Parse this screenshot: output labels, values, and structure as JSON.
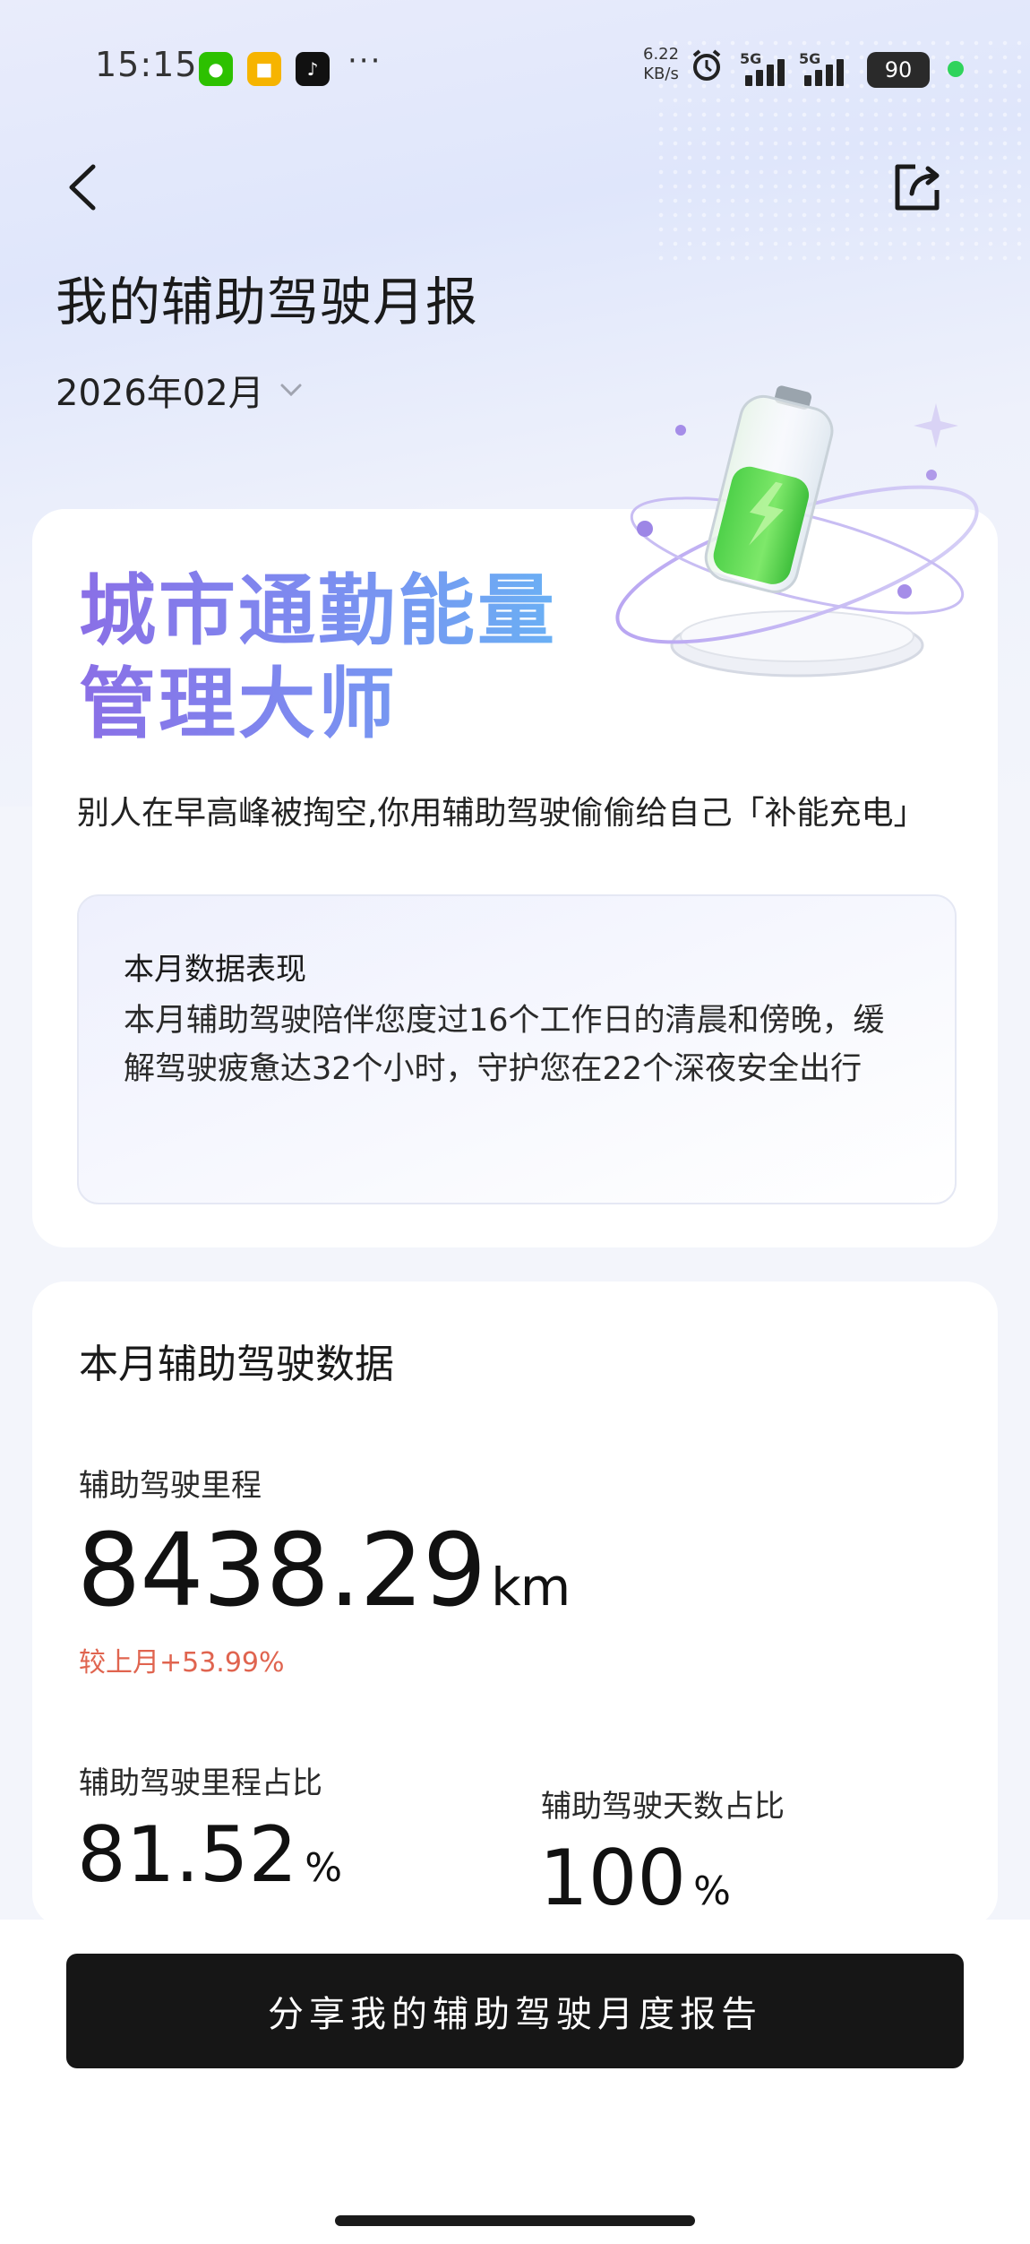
{
  "status_bar": {
    "time": "15:15",
    "net_speed_value": "6.22",
    "net_speed_unit": "KB/s",
    "signal1": "5G",
    "signal2": "5G",
    "battery": "90",
    "more": "···"
  },
  "header": {
    "title": "我的辅助驾驶月报",
    "month": "2026年02月"
  },
  "hero": {
    "headline_line1": "城市通勤能量",
    "headline_line2": "管理大师",
    "tagline": "别人在早高峰被掏空,你用辅助驾驶偷偷给自己「补能充电」"
  },
  "performance": {
    "title": "本月数据表现",
    "body": "本月辅助驾驶陪伴您度过16个工作日的清晨和傍晚，缓解驾驶疲惫达32个小时，守护您在22个深夜安全出行"
  },
  "stats": {
    "section_title": "本月辅助驾驶数据",
    "mileage_label": "辅助驾驶里程",
    "mileage_value": "8438.29",
    "mileage_unit": "km",
    "mileage_change": "较上月+53.99%",
    "mileage_ratio_label": "辅助驾驶里程占比",
    "mileage_ratio_value": "81.52",
    "days_ratio_label": "辅助驾驶天数占比",
    "days_ratio_value": "100",
    "percent_unit": "%"
  },
  "actions": {
    "share_button": "分享我的辅助驾驶月度报告"
  },
  "colors": {
    "headline_gradient_start": "#8a6fe6",
    "headline_gradient_end": "#6ab0f4",
    "change_red": "#e0644f",
    "button_bg": "#161616"
  }
}
